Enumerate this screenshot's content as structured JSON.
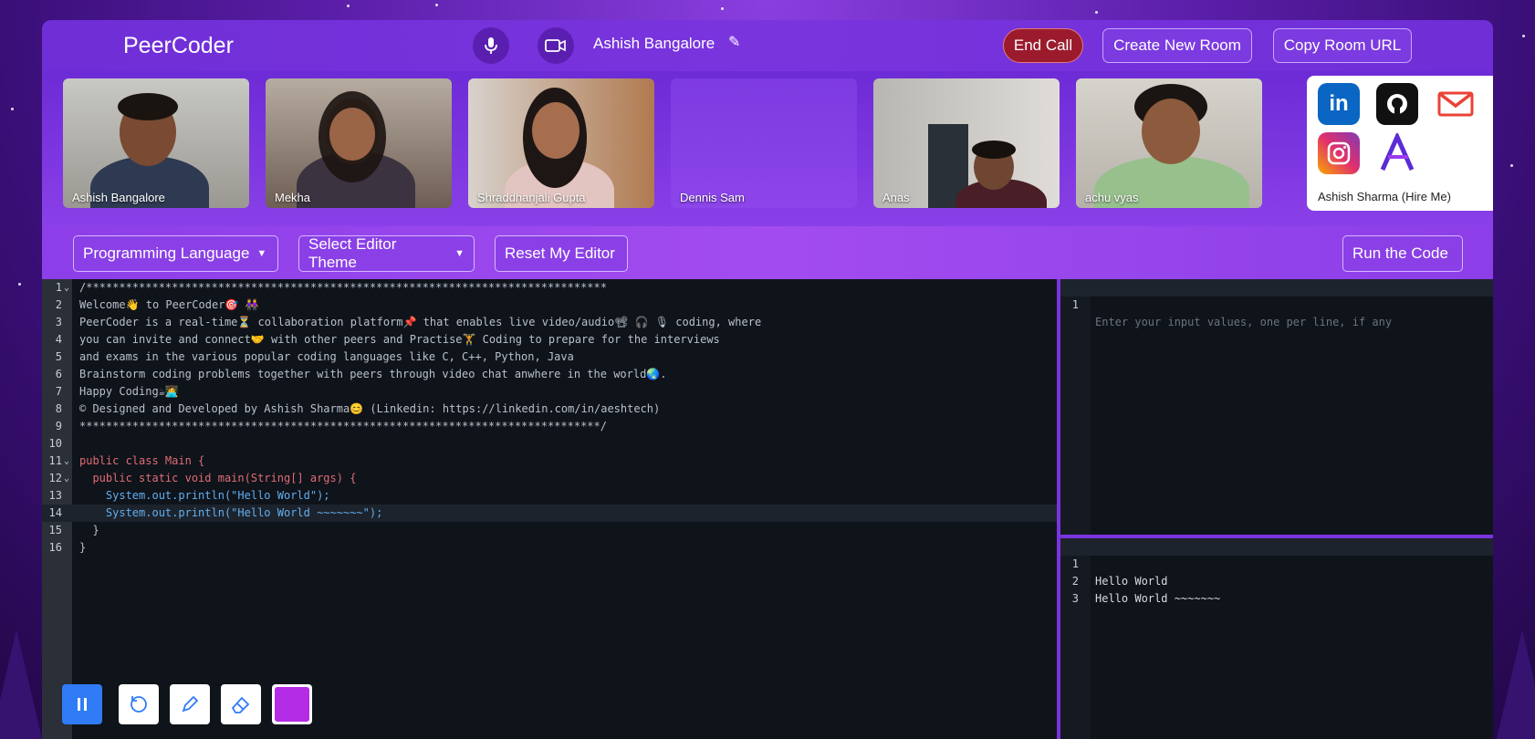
{
  "app": {
    "title": "PeerCoder"
  },
  "header": {
    "user_name": "Ashish Bangalore",
    "end_call_label": "End Call",
    "create_room_label": "Create New Room",
    "copy_url_label": "Copy Room URL",
    "icons": [
      "microphone-icon",
      "video-camera-icon",
      "edit-pencil-icon"
    ]
  },
  "participants": [
    {
      "name": "Ashish Bangalore",
      "video": true
    },
    {
      "name": "Mekha",
      "video": true
    },
    {
      "name": "Shraddhanjali Gupta",
      "video": true
    },
    {
      "name": "Dennis Sam",
      "video": false
    },
    {
      "name": "Anas",
      "video": true
    },
    {
      "name": "achu vyas",
      "video": true
    }
  ],
  "social": {
    "icons": [
      "linkedin-icon",
      "github-icon",
      "gmail-icon",
      "instagram-icon",
      "portfolio-icon"
    ],
    "caption": "Ashish Sharma (Hire Me)"
  },
  "toolbar": {
    "language_label": "Programming Language",
    "theme_label": "Select Editor Theme",
    "reset_label": "Reset My Editor",
    "run_label": "Run the Code"
  },
  "editor": {
    "lines": [
      "/*******************************************************************************",
      "Welcome👋 to PeerCoder🎯 👭",
      "PeerCoder is a real-time⏳ collaboration platform📌 that enables live video/audio📽 🎧 🎙 coding, where",
      "you can invite and connect🤝 with other peers and Practise🏋 Coding to prepare for the interviews",
      "and exams in the various popular coding languages like C, C++, Python, Java",
      "Brainstorm coding problems together with peers through video chat anwhere in the world🌏.",
      "Happy Coding☕👩‍💻",
      "© Designed and Developed by Ashish Sharma😊 (Linkedin: https://linkedin.com/in/aeshtech)",
      "*******************************************************************************/",
      "",
      "public class Main {",
      "  public static void main(String[] args) {",
      "    System.out.println(\"Hello World\");",
      "    System.out.println(\"Hello World ~~~~~~~\");",
      "  }",
      "}"
    ],
    "line_numbers": [
      "1",
      "2",
      "3",
      "4",
      "5",
      "6",
      "7",
      "8",
      "9",
      "10",
      "11",
      "12",
      "13",
      "14",
      "15",
      "16"
    ]
  },
  "input_panel": {
    "line_number": "1",
    "placeholder": "Enter your input values, one per line, if any"
  },
  "output_panel": {
    "line_numbers": [
      "1",
      "2",
      "3"
    ],
    "lines": [
      "Hello World",
      "Hello World ~~~~~~~",
      ""
    ]
  },
  "draw_tools": {
    "icons": [
      "pause-icon",
      "undo-icon",
      "pencil-icon",
      "eraser-icon",
      "color-swatch"
    ],
    "swatch_color": "#b42be6"
  },
  "colors": {
    "accent": "#7a34de",
    "end_call": "#9b1b2c",
    "editor_bg": "#0f131a"
  }
}
